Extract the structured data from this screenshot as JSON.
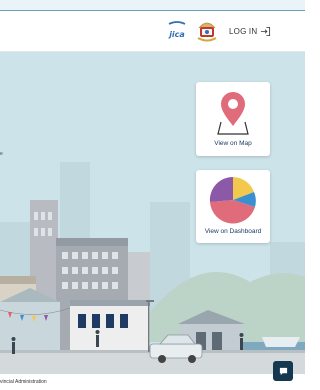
{
  "header": {
    "login_label": "LOG IN",
    "partner_logo": "jica-logo",
    "emblem": "government-emblem"
  },
  "hero": {
    "tagline_fragment": "e",
    "background_color": "#cde3ea"
  },
  "cards": [
    {
      "label": "View on Map",
      "icon": "map-pin-icon",
      "accent": "#e06b7a"
    },
    {
      "label": "View on Dashboard",
      "icon": "pie-chart-icon",
      "slice_colors": [
        "#e06b7a",
        "#8c58a8",
        "#f2c94c",
        "#3a8fd1"
      ]
    }
  ],
  "footer": {
    "text": "vincial Administration"
  },
  "chat": {
    "icon": "chat-icon"
  }
}
